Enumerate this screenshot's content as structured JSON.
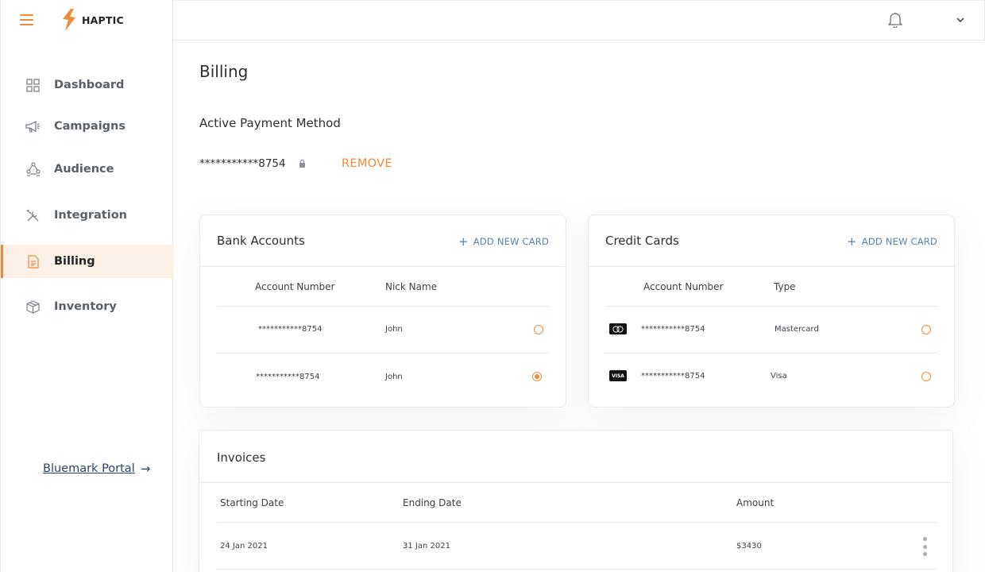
{
  "app": {
    "brand": "HAPTIC"
  },
  "sidebar": {
    "items": [
      {
        "label": "Dashboard",
        "icon": "grid-icon",
        "active": false
      },
      {
        "label": "Campaigns",
        "icon": "megaphone-icon",
        "active": false
      },
      {
        "label": "Audience",
        "icon": "people-network-icon",
        "active": false
      },
      {
        "label": "Integration",
        "icon": "tools-icon",
        "active": false
      },
      {
        "label": "Billing",
        "icon": "document-icon",
        "active": true
      },
      {
        "label": "Inventory",
        "icon": "box-icon",
        "active": false
      }
    ],
    "portal_link": "Bluemark Portal"
  },
  "header": {
    "bell_icon": "bell-icon",
    "menu_icon": "chevron-down-icon"
  },
  "page": {
    "title": "Billing"
  },
  "active_payment": {
    "title": "Active Payment Method",
    "number": "***********8754",
    "remove_label": "REMOVE"
  },
  "bank_accounts": {
    "title": "Bank Accounts",
    "add_label": "ADD NEW CARD",
    "columns": [
      "Account Number",
      "Nick Name"
    ],
    "rows": [
      {
        "account": "***********8754",
        "nick": "John",
        "selected": false
      },
      {
        "account": "***********8754",
        "nick": "John",
        "selected": true
      }
    ]
  },
  "credit_cards": {
    "title": "Credit Cards",
    "add_label": "ADD NEW CARD",
    "columns": [
      "Account Number",
      "Type"
    ],
    "rows": [
      {
        "icon": "mastercard-icon",
        "account": "***********8754",
        "type": "Mastercard",
        "selected": false
      },
      {
        "icon": "visa-icon",
        "icon_text": "VISA",
        "account": "***********8754",
        "type": "Visa",
        "selected": false
      }
    ]
  },
  "invoices": {
    "title": "Invoices",
    "columns": [
      "Starting Date",
      "Ending Date",
      "Amount"
    ],
    "rows": [
      {
        "start": "24 Jan 2021",
        "end": "31 Jan 2021",
        "amount": "$3430"
      }
    ]
  },
  "colors": {
    "accent": "#ef8a3a",
    "link": "#5a7fa8",
    "portal": "#2b3f6b"
  }
}
